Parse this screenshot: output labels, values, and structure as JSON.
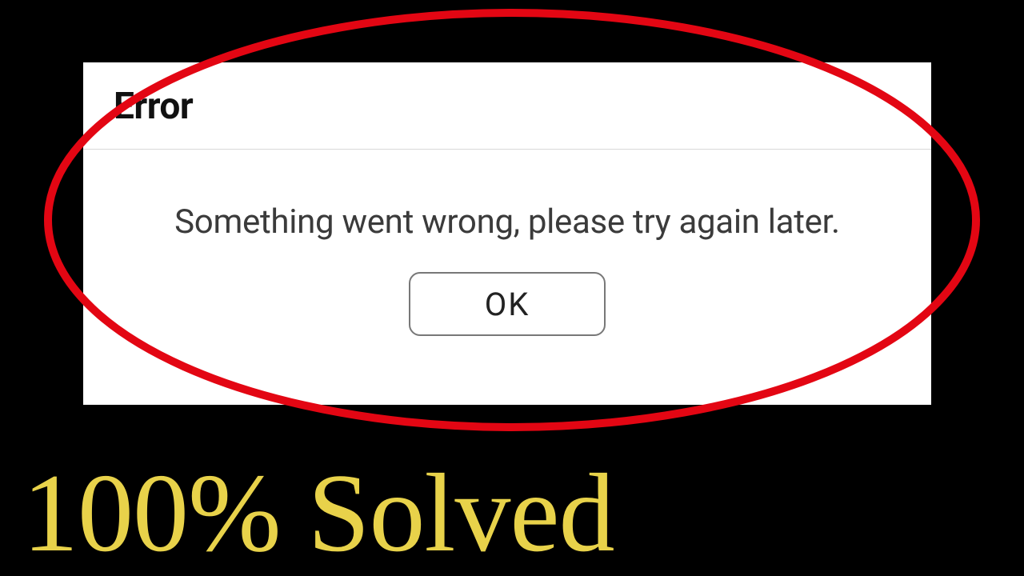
{
  "dialog": {
    "title": "Error",
    "message": "Something went wrong, please try again later.",
    "ok_label": "OK"
  },
  "caption": "100% Solved"
}
